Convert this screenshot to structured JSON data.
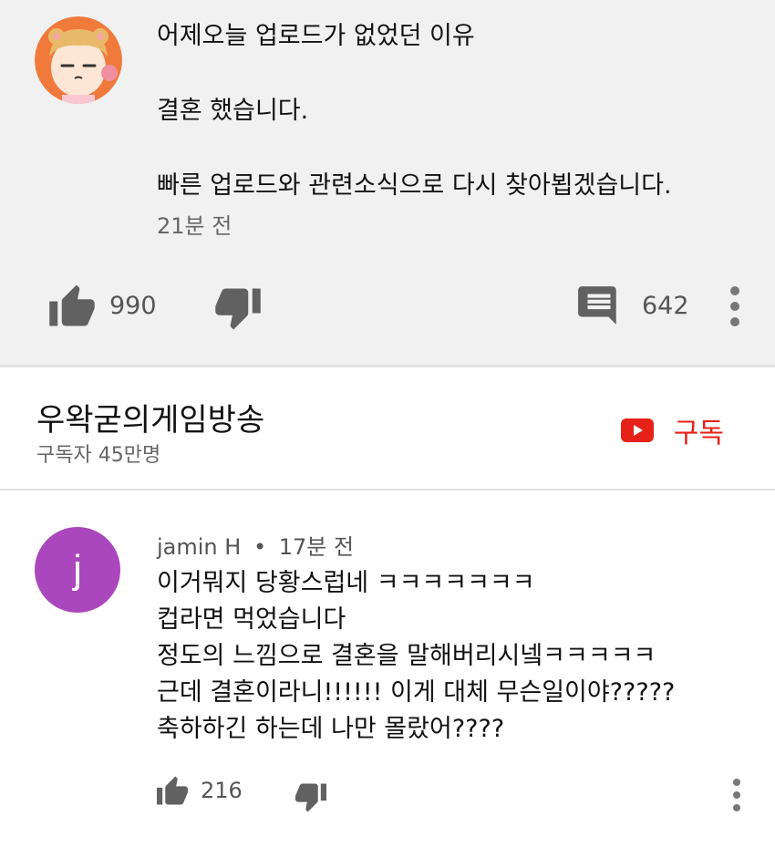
{
  "post": {
    "lines": [
      "어제오늘 업로드가 없었던 이유",
      "결혼 했습니다.",
      "빠른 업로드와 관련소식으로 다시 찾아뵙겠습니다."
    ],
    "time": "21분 전",
    "likes": "990",
    "replies": "642",
    "icons": {
      "like": "thumbs-up-icon",
      "dislike": "thumbs-down-icon",
      "comment": "comment-icon",
      "more": "more-vert-icon"
    }
  },
  "channel": {
    "name": "우왁굳의게임방송",
    "subscribers": "구독자 45만명",
    "subscribe_label": "구독",
    "accent": "#e62117"
  },
  "comment": {
    "avatar_letter": "j",
    "avatar_color": "#ab47bc",
    "author": "jamin H",
    "separator": "•",
    "time": "17분 전",
    "lines": [
      "이거뭐지 당황스럽네 ㅋㅋㅋㅋㅋㅋㅋ",
      " 컵라면 먹었습니다",
      "정도의 느낌으로 결혼을 말해버리시넼ㅋㅋㅋㅋㅋ",
      "근데 결혼이라니!!!!!! 이게 대체 무슨일이야?????",
      "축하하긴 하는데 나만 몰랐어????"
    ],
    "likes": "216"
  }
}
